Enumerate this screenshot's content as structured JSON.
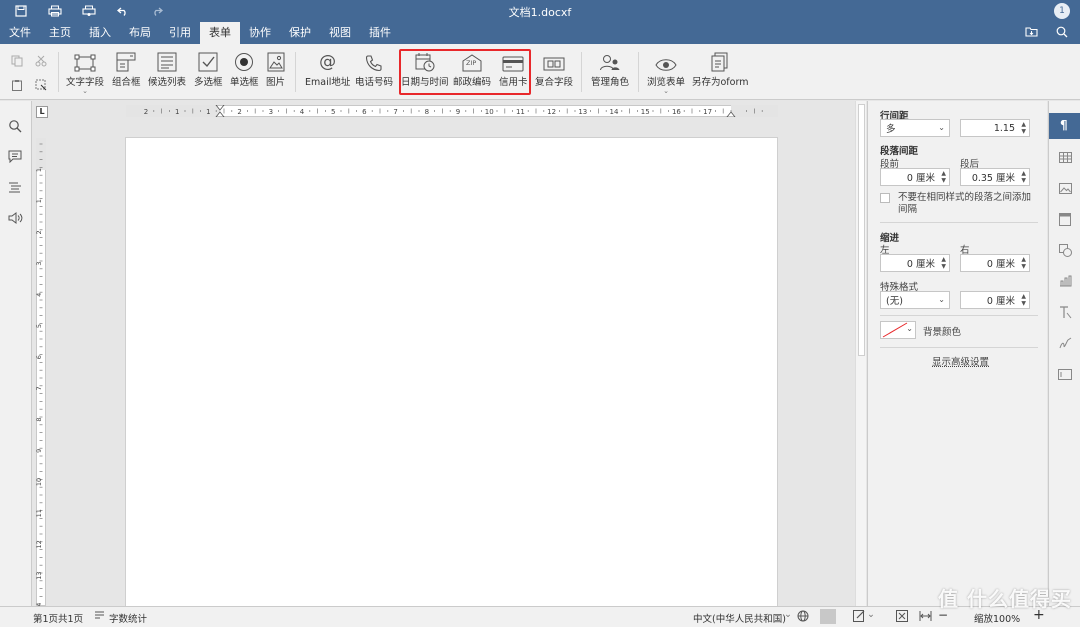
{
  "window": {
    "title": "文档1.docxf",
    "user_initial": "1"
  },
  "menu": {
    "tabs": [
      "文件",
      "主页",
      "插入",
      "布局",
      "引用",
      "表单",
      "协作",
      "保护",
      "视图",
      "插件"
    ],
    "active_tab": "表单"
  },
  "toolbar": {
    "text_field": "文字字段",
    "combo_box": "组合框",
    "dropdown_list": "候选列表",
    "checkbox": "多选框",
    "radio": "单选框",
    "image": "图片",
    "email": "Email地址",
    "phone": "电话号码",
    "datetime": "日期与时间",
    "zip": "邮政编码",
    "zip_icon_text": "ZIP",
    "credit_card": "信用卡",
    "complex_field": "复合字段",
    "manage_roles": "管理角色",
    "view_form": "浏览表单",
    "save_oform": "另存为oform"
  },
  "ruler": {
    "h_labels": [
      "2",
      "1",
      "1",
      "2",
      "3",
      "4",
      "5",
      "6",
      "7",
      "8",
      "9",
      "10",
      "11",
      "12",
      "13",
      "14",
      "15",
      "16",
      "17"
    ],
    "v_labels": [
      "1",
      "1",
      "2",
      "3",
      "4",
      "5",
      "6",
      "7",
      "8",
      "9",
      "10",
      "11",
      "12",
      "13",
      "14"
    ]
  },
  "paragraph": {
    "line_spacing_label": "行间距",
    "line_spacing_mode": "多",
    "line_spacing_value": "1.15",
    "para_spacing_label": "段落间距",
    "before_label": "段前",
    "before_value": "0 厘米",
    "after_label": "段后",
    "after_value": "0.35 厘米",
    "no_space_same_style": "不要在相同样式的段落之间添加间隔",
    "indent_label": "缩进",
    "left_label": "左",
    "left_value": "0 厘米",
    "right_label": "右",
    "right_value": "0 厘米",
    "special_label": "特殊格式",
    "special_value": "(无)",
    "special_amount": "0 厘米",
    "bg_color_label": "背景颜色",
    "advanced_link": "显示高级设置"
  },
  "status": {
    "page_info": "第1页共1页",
    "word_count": "字数统计",
    "language": "中文(中华人民共和国)",
    "zoom": "缩放100%"
  },
  "colors": {
    "brand": "#446995",
    "highlight": "#e8282b"
  },
  "watermark": "值 什么值得买"
}
